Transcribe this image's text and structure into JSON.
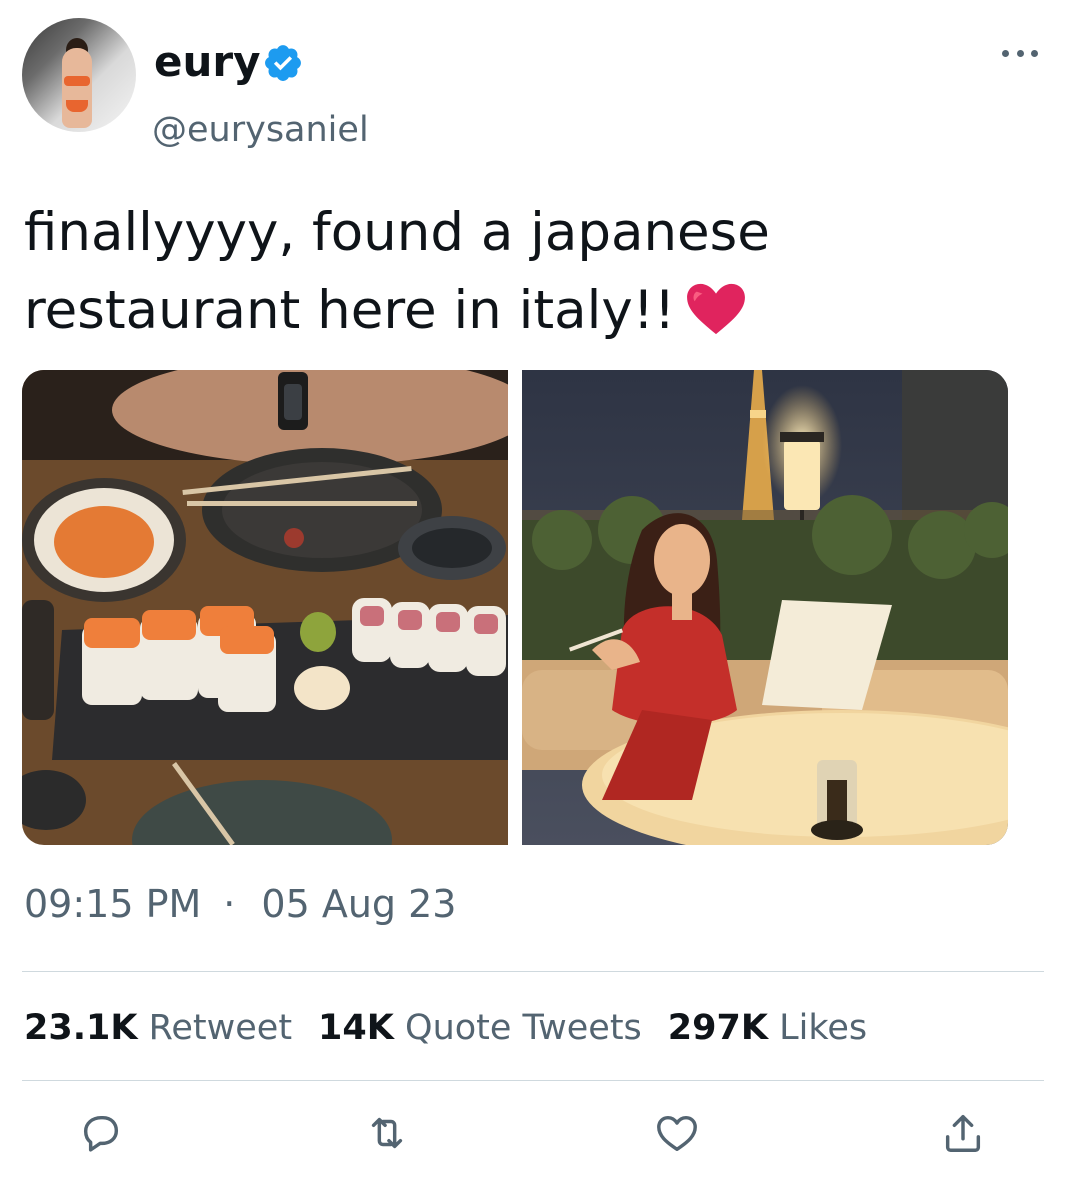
{
  "author": {
    "display_name": "eury",
    "handle": "@eurysaniel",
    "verified": true,
    "avatar_icon": "profile-photo"
  },
  "tweet": {
    "text": "finallyyyy, found a japanese restaurant here in italy!!",
    "emoji": "❤️",
    "media": [
      {
        "name": "sushi-dinner-photo"
      },
      {
        "name": "restaurant-terrace-photo"
      }
    ]
  },
  "meta": {
    "time": "09:15 PM",
    "separator": "·",
    "date": "05 Aug 23"
  },
  "stats": {
    "retweets_count": "23.1K",
    "retweets_label": "Retweet",
    "quotes_count": "14K",
    "quotes_label": "Quote Tweets",
    "likes_count": "297K",
    "likes_label": "Likes"
  },
  "actions": [
    {
      "name": "reply-icon"
    },
    {
      "name": "retweet-icon"
    },
    {
      "name": "like-icon"
    },
    {
      "name": "share-icon"
    }
  ],
  "colors": {
    "text_primary": "#0f1419",
    "text_secondary": "#536471",
    "verified_blue": "#1d9bf0",
    "divider": "#cfd9de",
    "heart_red": "#e0245e"
  }
}
